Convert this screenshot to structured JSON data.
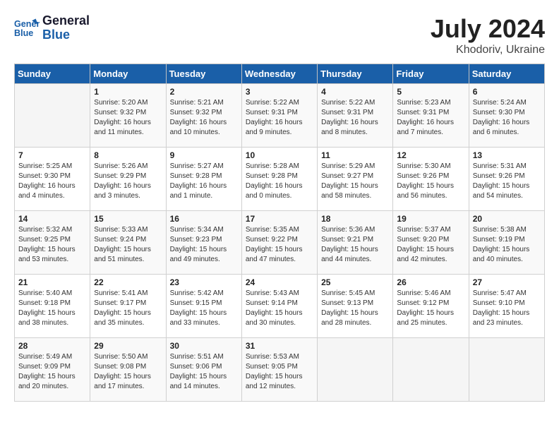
{
  "header": {
    "logo_line1": "General",
    "logo_line2": "Blue",
    "month": "July 2024",
    "location": "Khodoriv, Ukraine"
  },
  "weekdays": [
    "Sunday",
    "Monday",
    "Tuesday",
    "Wednesday",
    "Thursday",
    "Friday",
    "Saturday"
  ],
  "weeks": [
    [
      {
        "day": "",
        "info": ""
      },
      {
        "day": "1",
        "info": "Sunrise: 5:20 AM\nSunset: 9:32 PM\nDaylight: 16 hours\nand 11 minutes."
      },
      {
        "day": "2",
        "info": "Sunrise: 5:21 AM\nSunset: 9:32 PM\nDaylight: 16 hours\nand 10 minutes."
      },
      {
        "day": "3",
        "info": "Sunrise: 5:22 AM\nSunset: 9:31 PM\nDaylight: 16 hours\nand 9 minutes."
      },
      {
        "day": "4",
        "info": "Sunrise: 5:22 AM\nSunset: 9:31 PM\nDaylight: 16 hours\nand 8 minutes."
      },
      {
        "day": "5",
        "info": "Sunrise: 5:23 AM\nSunset: 9:31 PM\nDaylight: 16 hours\nand 7 minutes."
      },
      {
        "day": "6",
        "info": "Sunrise: 5:24 AM\nSunset: 9:30 PM\nDaylight: 16 hours\nand 6 minutes."
      }
    ],
    [
      {
        "day": "7",
        "info": "Sunrise: 5:25 AM\nSunset: 9:30 PM\nDaylight: 16 hours\nand 4 minutes."
      },
      {
        "day": "8",
        "info": "Sunrise: 5:26 AM\nSunset: 9:29 PM\nDaylight: 16 hours\nand 3 minutes."
      },
      {
        "day": "9",
        "info": "Sunrise: 5:27 AM\nSunset: 9:28 PM\nDaylight: 16 hours\nand 1 minute."
      },
      {
        "day": "10",
        "info": "Sunrise: 5:28 AM\nSunset: 9:28 PM\nDaylight: 16 hours\nand 0 minutes."
      },
      {
        "day": "11",
        "info": "Sunrise: 5:29 AM\nSunset: 9:27 PM\nDaylight: 15 hours\nand 58 minutes."
      },
      {
        "day": "12",
        "info": "Sunrise: 5:30 AM\nSunset: 9:26 PM\nDaylight: 15 hours\nand 56 minutes."
      },
      {
        "day": "13",
        "info": "Sunrise: 5:31 AM\nSunset: 9:26 PM\nDaylight: 15 hours\nand 54 minutes."
      }
    ],
    [
      {
        "day": "14",
        "info": "Sunrise: 5:32 AM\nSunset: 9:25 PM\nDaylight: 15 hours\nand 53 minutes."
      },
      {
        "day": "15",
        "info": "Sunrise: 5:33 AM\nSunset: 9:24 PM\nDaylight: 15 hours\nand 51 minutes."
      },
      {
        "day": "16",
        "info": "Sunrise: 5:34 AM\nSunset: 9:23 PM\nDaylight: 15 hours\nand 49 minutes."
      },
      {
        "day": "17",
        "info": "Sunrise: 5:35 AM\nSunset: 9:22 PM\nDaylight: 15 hours\nand 47 minutes."
      },
      {
        "day": "18",
        "info": "Sunrise: 5:36 AM\nSunset: 9:21 PM\nDaylight: 15 hours\nand 44 minutes."
      },
      {
        "day": "19",
        "info": "Sunrise: 5:37 AM\nSunset: 9:20 PM\nDaylight: 15 hours\nand 42 minutes."
      },
      {
        "day": "20",
        "info": "Sunrise: 5:38 AM\nSunset: 9:19 PM\nDaylight: 15 hours\nand 40 minutes."
      }
    ],
    [
      {
        "day": "21",
        "info": "Sunrise: 5:40 AM\nSunset: 9:18 PM\nDaylight: 15 hours\nand 38 minutes."
      },
      {
        "day": "22",
        "info": "Sunrise: 5:41 AM\nSunset: 9:17 PM\nDaylight: 15 hours\nand 35 minutes."
      },
      {
        "day": "23",
        "info": "Sunrise: 5:42 AM\nSunset: 9:15 PM\nDaylight: 15 hours\nand 33 minutes."
      },
      {
        "day": "24",
        "info": "Sunrise: 5:43 AM\nSunset: 9:14 PM\nDaylight: 15 hours\nand 30 minutes."
      },
      {
        "day": "25",
        "info": "Sunrise: 5:45 AM\nSunset: 9:13 PM\nDaylight: 15 hours\nand 28 minutes."
      },
      {
        "day": "26",
        "info": "Sunrise: 5:46 AM\nSunset: 9:12 PM\nDaylight: 15 hours\nand 25 minutes."
      },
      {
        "day": "27",
        "info": "Sunrise: 5:47 AM\nSunset: 9:10 PM\nDaylight: 15 hours\nand 23 minutes."
      }
    ],
    [
      {
        "day": "28",
        "info": "Sunrise: 5:49 AM\nSunset: 9:09 PM\nDaylight: 15 hours\nand 20 minutes."
      },
      {
        "day": "29",
        "info": "Sunrise: 5:50 AM\nSunset: 9:08 PM\nDaylight: 15 hours\nand 17 minutes."
      },
      {
        "day": "30",
        "info": "Sunrise: 5:51 AM\nSunset: 9:06 PM\nDaylight: 15 hours\nand 14 minutes."
      },
      {
        "day": "31",
        "info": "Sunrise: 5:53 AM\nSunset: 9:05 PM\nDaylight: 15 hours\nand 12 minutes."
      },
      {
        "day": "",
        "info": ""
      },
      {
        "day": "",
        "info": ""
      },
      {
        "day": "",
        "info": ""
      }
    ]
  ]
}
